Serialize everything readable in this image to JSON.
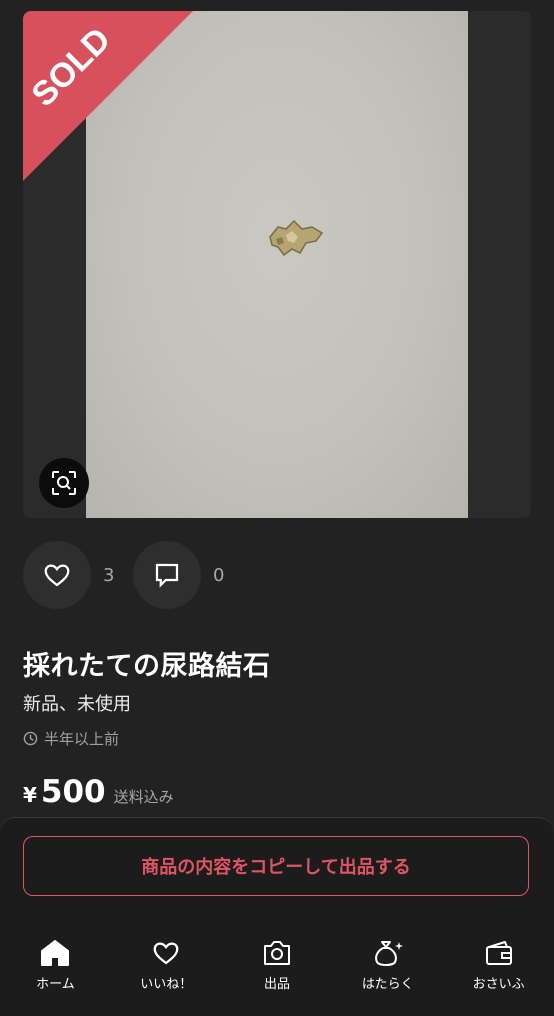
{
  "theme": {
    "background": "#222222",
    "accent": "#e05563",
    "sold_banner": "#d9505d"
  },
  "photo": {
    "sold_label": "SOLD",
    "zoom_icon": "zoom-scan-icon"
  },
  "actions": {
    "like": {
      "icon": "heart-icon",
      "count": "3"
    },
    "comment": {
      "icon": "comment-icon",
      "count": "0"
    }
  },
  "item": {
    "title": "採れたての尿路結石",
    "condition": "新品、未使用",
    "posted": "半年以上前",
    "currency": "¥",
    "price": "500",
    "shipping": "送料込み"
  },
  "copy_button": {
    "label": "商品の内容をコピーして出品する"
  },
  "tabbar": {
    "tabs": [
      {
        "label": "ホーム",
        "icon": "home-icon"
      },
      {
        "label": "いいね！",
        "icon": "heart-icon"
      },
      {
        "label": "出品",
        "icon": "camera-icon"
      },
      {
        "label": "はたらく",
        "icon": "money-bag-icon"
      },
      {
        "label": "おさいふ",
        "icon": "wallet-icon"
      }
    ]
  }
}
